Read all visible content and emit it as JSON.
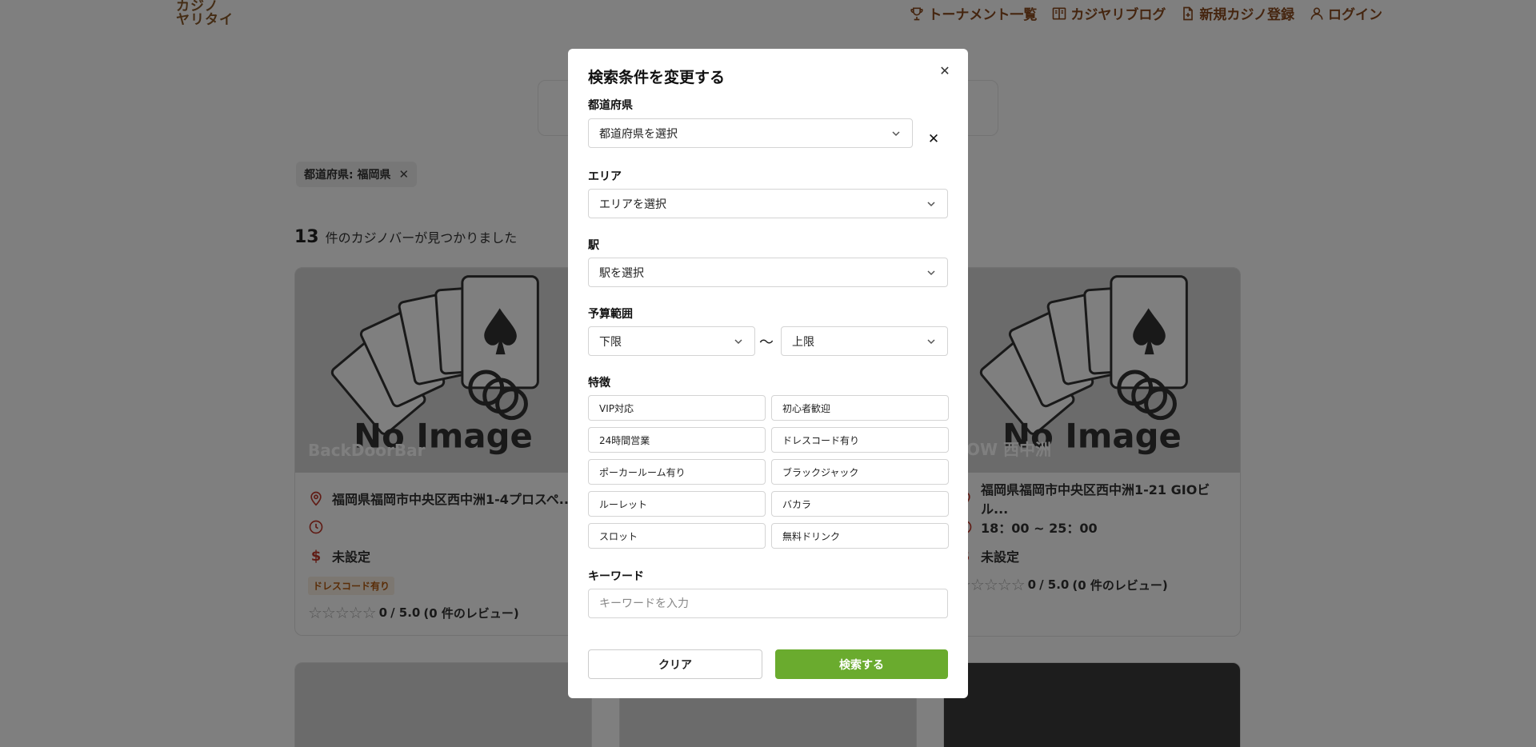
{
  "header": {
    "logo_line1": "カジノ",
    "logo_line2": "ヤリタイ",
    "nav": [
      {
        "label": "トーナメント一覧",
        "icon": "trophy-icon"
      },
      {
        "label": "カジヤリブログ",
        "icon": "book-icon"
      },
      {
        "label": "新規カジノ登録",
        "icon": "file-plus-icon"
      },
      {
        "label": "ログイン",
        "icon": "user-icon"
      }
    ]
  },
  "filters": {
    "chip_label": "都道府県: 福岡県"
  },
  "results": {
    "count": "13",
    "count_text": "件のカジノバーが見つかりました"
  },
  "cards": [
    {
      "name": "BackDoorBar",
      "image_placeholder": "No Image",
      "address": "福岡県福岡市中央区西中洲1-4プロスペ...",
      "hours": "",
      "budget": "未設定",
      "tag": "ドレスコード有り",
      "rating": "0",
      "rating_max": "/ 5.0",
      "reviews": "(0 件のレビュー)"
    },
    {
      "name": "LOW 西中洲",
      "image_placeholder": "No Image",
      "address": "福岡県福岡市中央区西中洲1-21 GIOビル...",
      "hours": "18：00 ~ 25：00",
      "budget": "未設定",
      "rating": "0",
      "rating_max": "/ 5.0",
      "reviews": "(0 件のレビュー)"
    }
  ],
  "modal": {
    "title": "検索条件を変更する",
    "prefecture": {
      "label": "都道府県",
      "placeholder": "都道府県を選択"
    },
    "area": {
      "label": "エリア",
      "placeholder": "エリアを選択"
    },
    "station": {
      "label": "駅",
      "placeholder": "駅を選択"
    },
    "budget": {
      "label": "予算範囲",
      "min_placeholder": "下限",
      "separator": "〜",
      "max_placeholder": "上限"
    },
    "features": {
      "label": "特徴",
      "items": [
        "VIP対応",
        "初心者歓迎",
        "24時間営業",
        "ドレスコード有り",
        "ポーカールーム有り",
        "ブラックジャック",
        "ルーレット",
        "バカラ",
        "スロット",
        "無料ドリンク"
      ]
    },
    "keyword": {
      "label": "キーワード",
      "placeholder": "キーワードを入力"
    },
    "clear_button": "クリア",
    "search_button": "検索する"
  },
  "colors": {
    "accent": "#6aab2e",
    "brand": "#8a4a1e",
    "overlay": "rgba(0,0,0,0.5)"
  }
}
